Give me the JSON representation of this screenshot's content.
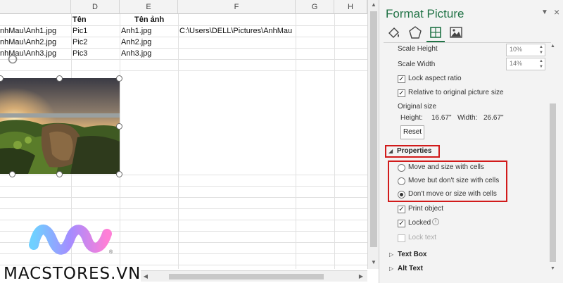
{
  "sheet": {
    "columns": [
      "D",
      "E",
      "F",
      "G",
      "H"
    ],
    "header_row": {
      "d": "Tên",
      "e": "Tên ảnh"
    },
    "rows": [
      {
        "c": "nhMau\\Anh1.jpg",
        "d": "Pic1",
        "e": "Anh1.jpg",
        "f": "C:\\Users\\DELL\\Pictures\\AnhMau"
      },
      {
        "c": "nhMau\\Anh2.jpg",
        "d": "Pic2",
        "e": "Anh2.jpg",
        "f": ""
      },
      {
        "c": "nhMau\\Anh3.jpg",
        "d": "Pic3",
        "e": "Anh3.jpg",
        "f": ""
      }
    ]
  },
  "brand": "MACSTORES.VN",
  "brand_mark": "®",
  "pane": {
    "title": "Format Picture",
    "ctrl_icon": "chevron-down-icon",
    "close": "×",
    "tabs": [
      "fill-line-icon",
      "effects-icon",
      "size-properties-icon",
      "picture-icon"
    ],
    "size": {
      "scale_height_label": "Scale Height",
      "scale_height_value": "10%",
      "scale_width_label": "Scale Width",
      "scale_width_value": "14%",
      "lock_aspect_label": "Lock aspect ratio",
      "relative_label": "Relative to original picture size",
      "original_size_label": "Original size",
      "height_label": "Height:",
      "height_value": "16.67\"",
      "width_label": "Width:",
      "width_value": "26.67\"",
      "reset_label": "Reset"
    },
    "properties": {
      "header": "Properties",
      "options": [
        {
          "label": "Move and size with cells",
          "selected": false
        },
        {
          "label": "Move but don't size with cells",
          "selected": false
        },
        {
          "label": "Don't move or size with cells",
          "selected": true
        }
      ],
      "print_object_label": "Print object",
      "locked_label": "Locked",
      "lock_text_label": "Lock text"
    },
    "text_box_header": "Text Box",
    "alt_text_header": "Alt Text"
  },
  "colors": {
    "accent": "#217346",
    "highlight": "#d11a1a"
  }
}
